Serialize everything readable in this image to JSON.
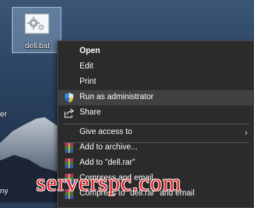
{
  "desktop": {
    "icon_label": "dell.bat",
    "edge_labels": [
      "er",
      "ny"
    ]
  },
  "context_menu": {
    "items": [
      {
        "label": "Open",
        "icon": "none",
        "bold": true
      },
      {
        "label": "Edit",
        "icon": "none"
      },
      {
        "label": "Print",
        "icon": "none"
      },
      {
        "label": "Run as administrator",
        "icon": "uac-shield-icon",
        "highlighted": true
      },
      {
        "label": "Share",
        "icon": "share-icon"
      },
      {
        "label": "Give access to",
        "icon": "none",
        "submenu": true
      },
      {
        "label": "Add to archive...",
        "icon": "winrar-icon"
      },
      {
        "label": "Add to \"dell.rar\"",
        "icon": "winrar-icon"
      },
      {
        "label": "Compress and email...",
        "icon": "winrar-icon"
      },
      {
        "label": "Compress to \"dell.rar\" and email",
        "icon": "winrar-icon"
      }
    ],
    "submenu_arrow": "›"
  },
  "watermark": {
    "text": "serverspc.com"
  },
  "colors": {
    "menu_bg": "#2b2b2b",
    "menu_hover": "#414141",
    "watermark": "#e0262b"
  }
}
